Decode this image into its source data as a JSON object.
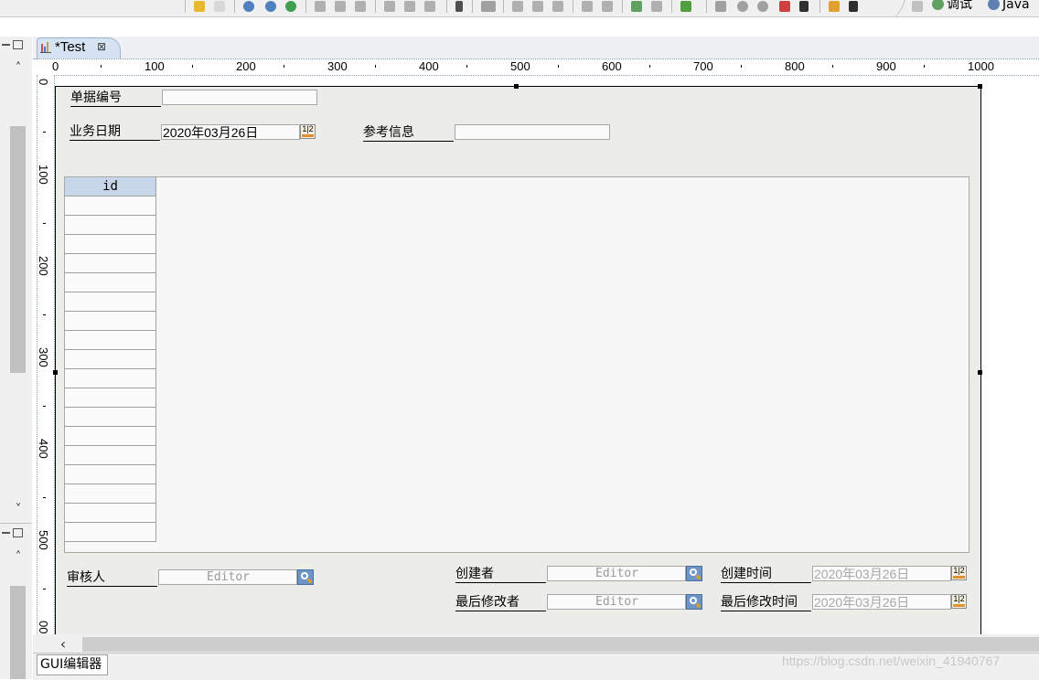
{
  "toolbar": {
    "perspectives": [
      {
        "label": "调试",
        "icon": "debug-perspective-icon"
      },
      {
        "label": "Java",
        "icon": "java-perspective-icon"
      }
    ]
  },
  "editor_tab": {
    "title": "*Test",
    "icon": "chart-file-icon"
  },
  "ruler": {
    "horizontal": [
      "0",
      "100",
      "200",
      "300",
      "400",
      "500",
      "600",
      "700",
      "800",
      "900",
      "1000"
    ],
    "vertical": [
      "0",
      "100",
      "200",
      "300",
      "400",
      "500",
      "00"
    ]
  },
  "form": {
    "bill_no": {
      "label": "单据编号",
      "value": ""
    },
    "business_date": {
      "label": "业务日期",
      "value": "2020年03月26日"
    },
    "reference_info": {
      "label": "参考信息",
      "value": ""
    },
    "table": {
      "columns": [
        "id"
      ],
      "empty_rows": 18
    },
    "reviewer": {
      "label": "审核人",
      "placeholder": "Editor"
    },
    "creator": {
      "label": "创建者",
      "placeholder": "Editor"
    },
    "created_time": {
      "label": "创建时间",
      "value": "2020年03月26日"
    },
    "last_modifier": {
      "label": "最后修改者",
      "placeholder": "Editor"
    },
    "last_modified_time": {
      "label": "最后修改时间",
      "value": "2020年03月26日"
    }
  },
  "calendar_icon_text": "1|2",
  "bottom_tab": {
    "label": "GUI编辑器"
  },
  "watermark": "https://blog.csdn.net/weixin_41940767",
  "colors": {
    "canvas_bg": "#ecece8",
    "table_header": "#c7d6e8",
    "lookup_button": "#6f95c8",
    "tab_active": "#d6e3f3"
  }
}
